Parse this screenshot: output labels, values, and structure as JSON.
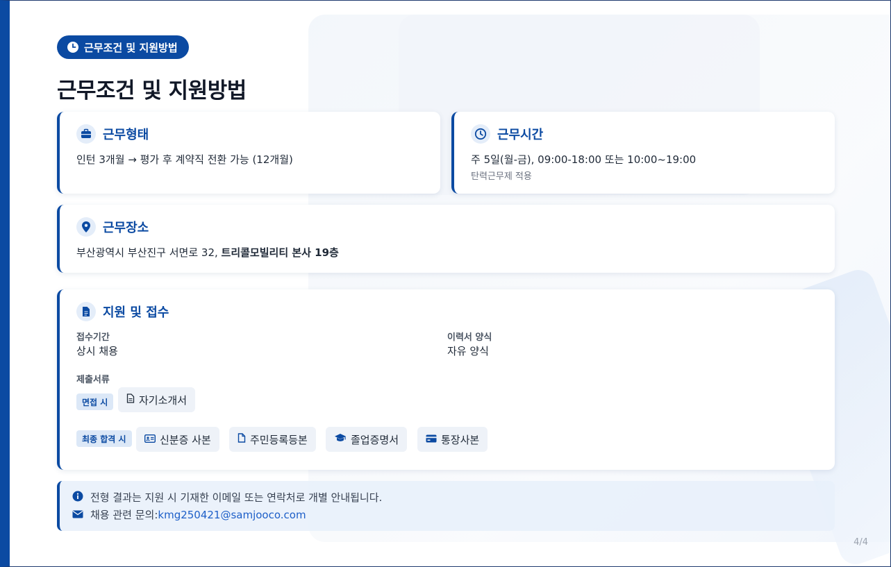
{
  "badge": {
    "label": "근무조건 및 지원방법",
    "icon": "clock-icon"
  },
  "page_title": "근무조건 및 지원방법",
  "work_type": {
    "title": "근무형태",
    "icon": "briefcase-icon",
    "text": "인턴 3개월 → 평가 후 계약직 전환 가능 (12개월)"
  },
  "work_hours": {
    "title": "근무시간",
    "icon": "clock-icon",
    "text": "주 5일(월-금), 09:00-18:00 또는 10:00~19:00",
    "note": "탄력근무제 적용"
  },
  "work_location": {
    "title": "근무장소",
    "icon": "map-pin-icon",
    "text_prefix": "부산광역시 부산진구 서면로 32, ",
    "text_strong": "트리콜모빌리티 본사 19층"
  },
  "application": {
    "title": "지원 및 접수",
    "icon": "file-icon",
    "period_label": "접수기간",
    "period_value": "상시 채용",
    "resume_label": "이력서 양식",
    "resume_value": "자유 양식",
    "docs_label": "제출서류",
    "interview_tag": "면접 시",
    "interview_docs": [
      {
        "label": "자기소개서",
        "icon": "document-icon"
      }
    ],
    "final_tag": "최종 합격 시",
    "final_docs": [
      {
        "label": "신분증 사본",
        "icon": "id-card-icon"
      },
      {
        "label": "주민등록등본",
        "icon": "document-icon"
      },
      {
        "label": "졸업증명서",
        "icon": "graduation-cap-icon"
      },
      {
        "label": "통장사본",
        "icon": "bank-card-icon"
      }
    ]
  },
  "notice": {
    "line1": "전형 결과는 지원 시 기재한 이메일 또는 연락처로 개별 안내됩니다.",
    "line2_prefix": "채용 관련 문의:",
    "email": "kmg250421@samjooco.com"
  },
  "page_number": "4/4",
  "colors": {
    "accent": "#0b4aa2",
    "link": "#1d5fc8",
    "tag_bg": "#dce8f7"
  }
}
